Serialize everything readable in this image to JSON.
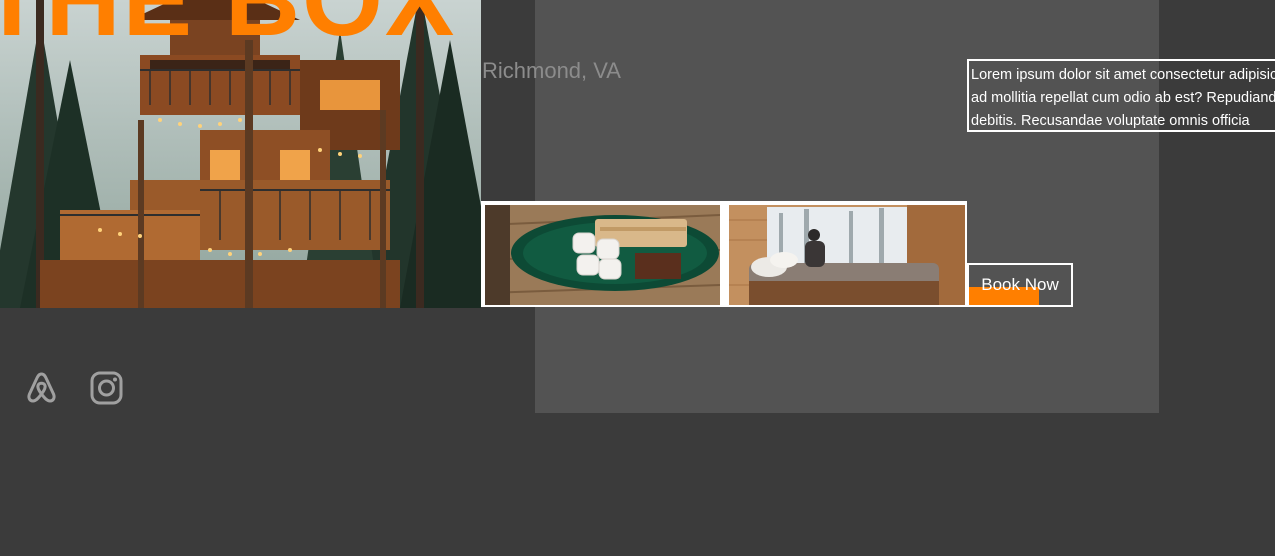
{
  "brand": {
    "title": "THE BOX",
    "location": "Richmond, VA"
  },
  "description": {
    "lines": [
      "Lorem ipsum dolor sit amet consectetur adipisicing elit.",
      "ad mollitia repellat cum odio ab est? Repudiandae",
      "debitis. Recusandae voluptate omnis officia"
    ]
  },
  "gallery": {
    "images": [
      "smores-plate-image",
      "cabin-bed-window-image"
    ]
  },
  "booking": {
    "button_label": "Book Now"
  },
  "social": {
    "icons": [
      "airbnb-icon",
      "instagram-icon"
    ]
  },
  "colors": {
    "accent": "#ff7f00",
    "background": "#3b3b3b",
    "panel": "#535353",
    "muted_text": "#8c8c8c",
    "icon": "#a0a0a0"
  }
}
